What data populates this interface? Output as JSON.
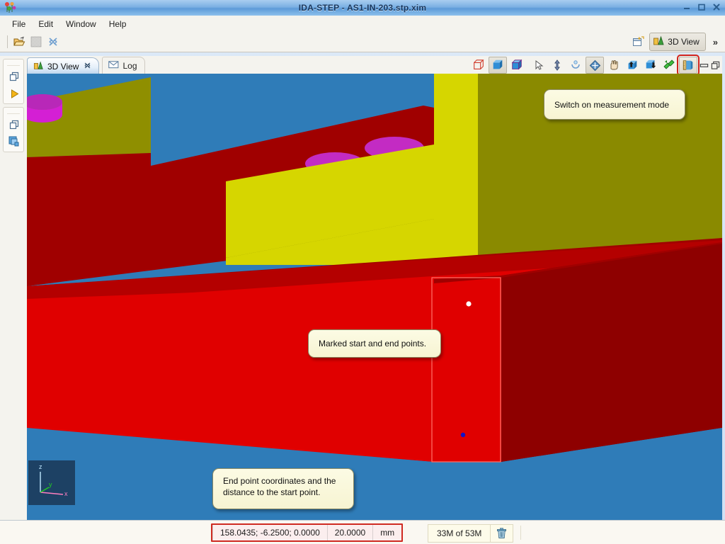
{
  "window": {
    "title": "IDA-STEP - AS1-IN-203.stp.xim",
    "logo_icon": "ida-step-logo-icon",
    "minimize_label": "–",
    "maximize_label": "□",
    "close_label": "✕"
  },
  "menu": {
    "items": [
      {
        "label": "File"
      },
      {
        "label": "Edit"
      },
      {
        "label": "Window"
      },
      {
        "label": "Help"
      }
    ]
  },
  "toolbar": {
    "buttons": [
      {
        "name": "open-file-button",
        "icon": "open-folder-icon",
        "label": "Open"
      },
      {
        "name": "save-button",
        "icon": "save-disk-icon",
        "label": "Save"
      },
      {
        "name": "close-button",
        "icon": "close-cross-icon",
        "label": "Close"
      }
    ],
    "perspective": {
      "new_perspective_icon": "new-perspective-icon",
      "active_label": "3D View",
      "active_icon": "3d-view-icon",
      "overflow_label": "»"
    }
  },
  "left_rail": {
    "groups": [
      {
        "buttons": [
          {
            "name": "restore-view-button",
            "icon": "restore-window-icon"
          },
          {
            "name": "expand-view-button",
            "icon": "play-triangle-icon"
          }
        ]
      },
      {
        "buttons": [
          {
            "name": "restore-view-button-2",
            "icon": "restore-window-icon"
          },
          {
            "name": "model-tree-button",
            "icon": "stacked-squares-icon"
          }
        ]
      }
    ]
  },
  "editor": {
    "tabs": [
      {
        "label": "3D View",
        "icon": "3d-view-icon",
        "active": true,
        "closable": true,
        "close_glyph": "✖"
      },
      {
        "label": "Log",
        "icon": "envelope-icon",
        "active": false,
        "closable": false
      }
    ],
    "view_toolbar": [
      {
        "name": "wireframe-button",
        "icon": "wireframe-box-icon",
        "state": "normal"
      },
      {
        "name": "shaded-button",
        "icon": "shaded-box-icon",
        "state": "toggled"
      },
      {
        "name": "shaded-edges-button",
        "icon": "shaded-edges-box-icon",
        "state": "normal"
      },
      {
        "name": "select-pointer-button",
        "icon": "cursor-arrow-icon",
        "state": "normal"
      },
      {
        "name": "pan-vertical-button",
        "icon": "vertical-arrows-icon",
        "state": "normal"
      },
      {
        "name": "rotate-button",
        "icon": "rotate-arc-icon",
        "state": "normal"
      },
      {
        "name": "fit-all-button",
        "icon": "fit-diamond-icon",
        "state": "toggled"
      },
      {
        "name": "hand-pan-button",
        "icon": "hand-icon",
        "state": "normal"
      },
      {
        "name": "zoom-in-button",
        "icon": "box-arrow-up-icon",
        "state": "normal"
      },
      {
        "name": "zoom-out-button",
        "icon": "box-arrow-down-icon",
        "state": "normal"
      },
      {
        "name": "refresh-view-button",
        "icon": "green-refresh-icon",
        "state": "normal"
      },
      {
        "name": "measurement-mode-button",
        "icon": "ruler-measure-icon",
        "state": "highlighted"
      }
    ],
    "minimize_glyph": "▭",
    "maximize_glyph": "❐"
  },
  "callouts": [
    {
      "name": "callout-measurement-mode",
      "text": "Switch on measurement mode"
    },
    {
      "name": "callout-marked-points",
      "text": "Marked start and end points."
    },
    {
      "name": "callout-end-point-coords",
      "text": "End point coordinates and the distance to the start point."
    }
  ],
  "status": {
    "measurement": {
      "coordinates": "158.0435; -6.2500; 0.0000",
      "distance": "20.0000",
      "units": "mm"
    },
    "memory": {
      "text": "33M of 53M",
      "trash_icon": "trash-can-icon"
    }
  },
  "viewport": {
    "axis_widget": {
      "x_label": "x",
      "y_label": "y",
      "z_label": "z",
      "x_color": "#ff7fbf",
      "y_color": "#22cc22",
      "z_color": "#bfe8ff",
      "background": "#1d4164"
    },
    "background_color": "#2f7cb8",
    "colors": {
      "base_red_top": "#e60000",
      "base_red_dark": "#a00000",
      "olive": "#8f8f00",
      "yellow": "#d6d600",
      "magenta": "#c32bc3",
      "magenta_bright": "#e61fe6",
      "selection_rect": "#ff6b63",
      "start_point": "#ffffff",
      "end_point": "#1212c8"
    }
  }
}
